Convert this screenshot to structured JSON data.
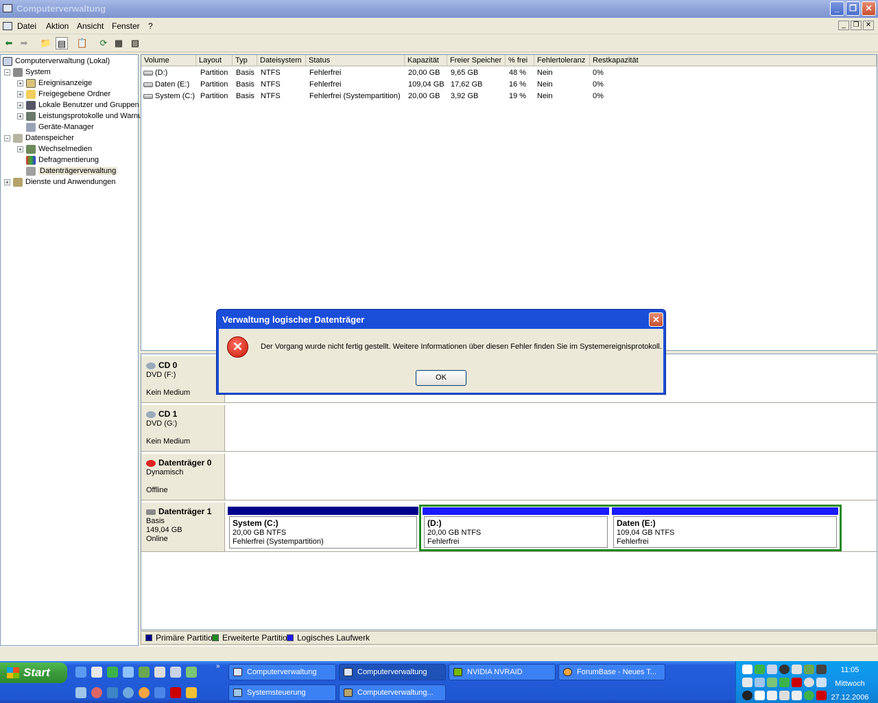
{
  "window": {
    "title": "Computerverwaltung"
  },
  "menu": {
    "items": [
      "Datei",
      "Aktion",
      "Ansicht",
      "Fenster",
      "?"
    ]
  },
  "tree": {
    "items": [
      {
        "label": "Computerverwaltung (Lokal)",
        "icon": "computer-icon"
      },
      {
        "label": "System",
        "icon": "system-tools-icon"
      },
      {
        "label": "Ereignisanzeige",
        "icon": "event-viewer-icon"
      },
      {
        "label": "Freigegebene Ordner",
        "icon": "shared-folder-icon"
      },
      {
        "label": "Lokale Benutzer und Gruppen",
        "icon": "users-icon"
      },
      {
        "label": "Leistungsprotokolle und Warnungen",
        "icon": "performance-icon"
      },
      {
        "label": "Geräte-Manager",
        "icon": "device-manager-icon"
      },
      {
        "label": "Datenspeicher",
        "icon": "storage-icon"
      },
      {
        "label": "Wechselmedien",
        "icon": "removable-media-icon"
      },
      {
        "label": "Defragmentierung",
        "icon": "defrag-icon"
      },
      {
        "label": "Datenträgerverwaltung",
        "icon": "disk-management-icon"
      },
      {
        "label": "Dienste und Anwendungen",
        "icon": "services-icon"
      }
    ]
  },
  "volumes": {
    "columns": [
      "Volume",
      "Layout",
      "Typ",
      "Dateisystem",
      "Status",
      "Kapazität",
      "Freier Speicher",
      "% frei",
      "Fehlertoleranz",
      "Restkapazität"
    ],
    "rows": [
      [
        "(D:)",
        "Partition",
        "Basis",
        "NTFS",
        "Fehlerfrei",
        "20,00 GB",
        "9,65 GB",
        "48 %",
        "Nein",
        "0%"
      ],
      [
        "Daten (E:)",
        "Partition",
        "Basis",
        "NTFS",
        "Fehlerfrei",
        "109,04 GB",
        "17,62 GB",
        "16 %",
        "Nein",
        "0%"
      ],
      [
        "System (C:)",
        "Partition",
        "Basis",
        "NTFS",
        "Fehlerfrei (Systempartition)",
        "20,00 GB",
        "3,92 GB",
        "19 %",
        "Nein",
        "0%"
      ]
    ]
  },
  "disks": {
    "cd0": {
      "name": "CD 0",
      "type": "DVD (F:)",
      "status": "Kein Medium"
    },
    "cd1": {
      "name": "CD 1",
      "type": "DVD (G:)",
      "status": "Kein Medium"
    },
    "disk0": {
      "name": "Datenträger 0",
      "type": "Dynamisch",
      "status": "Offline"
    },
    "disk1": {
      "name": "Datenträger 1",
      "type": "Basis",
      "size": "149,04 GB",
      "status": "Online",
      "partitions": [
        {
          "name": "System  (C:)",
          "size": "20,00 GB NTFS",
          "status": "Fehlerfrei (Systempartition)"
        },
        {
          "name": " (D:)",
          "size": "20,00 GB NTFS",
          "status": "Fehlerfrei"
        },
        {
          "name": "Daten  (E:)",
          "size": "109,04 GB NTFS",
          "status": "Fehlerfrei"
        }
      ]
    }
  },
  "legend": {
    "primary": "Primäre Partition",
    "extended": "Erweiterte Partition",
    "logical": "Logisches Laufwerk"
  },
  "colors": {
    "primary": "#00008b",
    "extended": "#1e8a1e",
    "logical": "#1a1aff"
  },
  "dialog": {
    "title": "Verwaltung logischer Datenträger",
    "message": "Der Vorgang wurde nicht fertig gestellt. Weitere Informationen über diesen Fehler finden Sie im Systemereignisprotokoll.",
    "ok": "OK"
  },
  "taskbar": {
    "start": "Start",
    "tasks_row1": [
      "Computerverwaltung",
      "Computerverwaltung",
      "NVIDIA NVRAID",
      "ForumBase - Neues T..."
    ],
    "tasks_row2": [
      "Systemsteuerung",
      "Computerverwaltung..."
    ],
    "clock": {
      "time": "11:05",
      "day": "Mittwoch",
      "date": "27.12.2006"
    }
  }
}
